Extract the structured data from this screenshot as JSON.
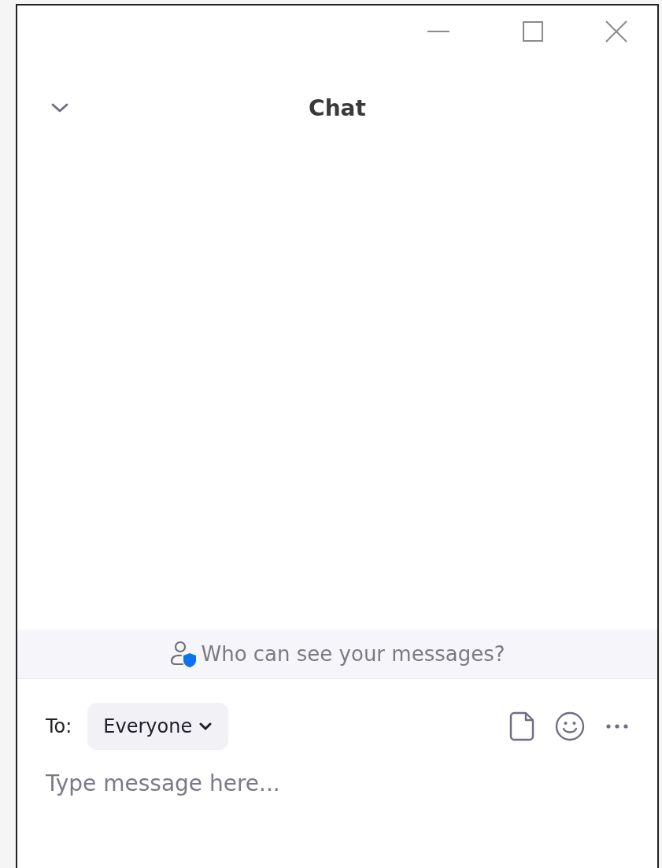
{
  "window": {
    "title": "Chat"
  },
  "privacy_notice": {
    "text": "Who can see your messages?"
  },
  "composer": {
    "to_label": "To:",
    "recipient": "Everyone",
    "placeholder": "Type message here..."
  }
}
